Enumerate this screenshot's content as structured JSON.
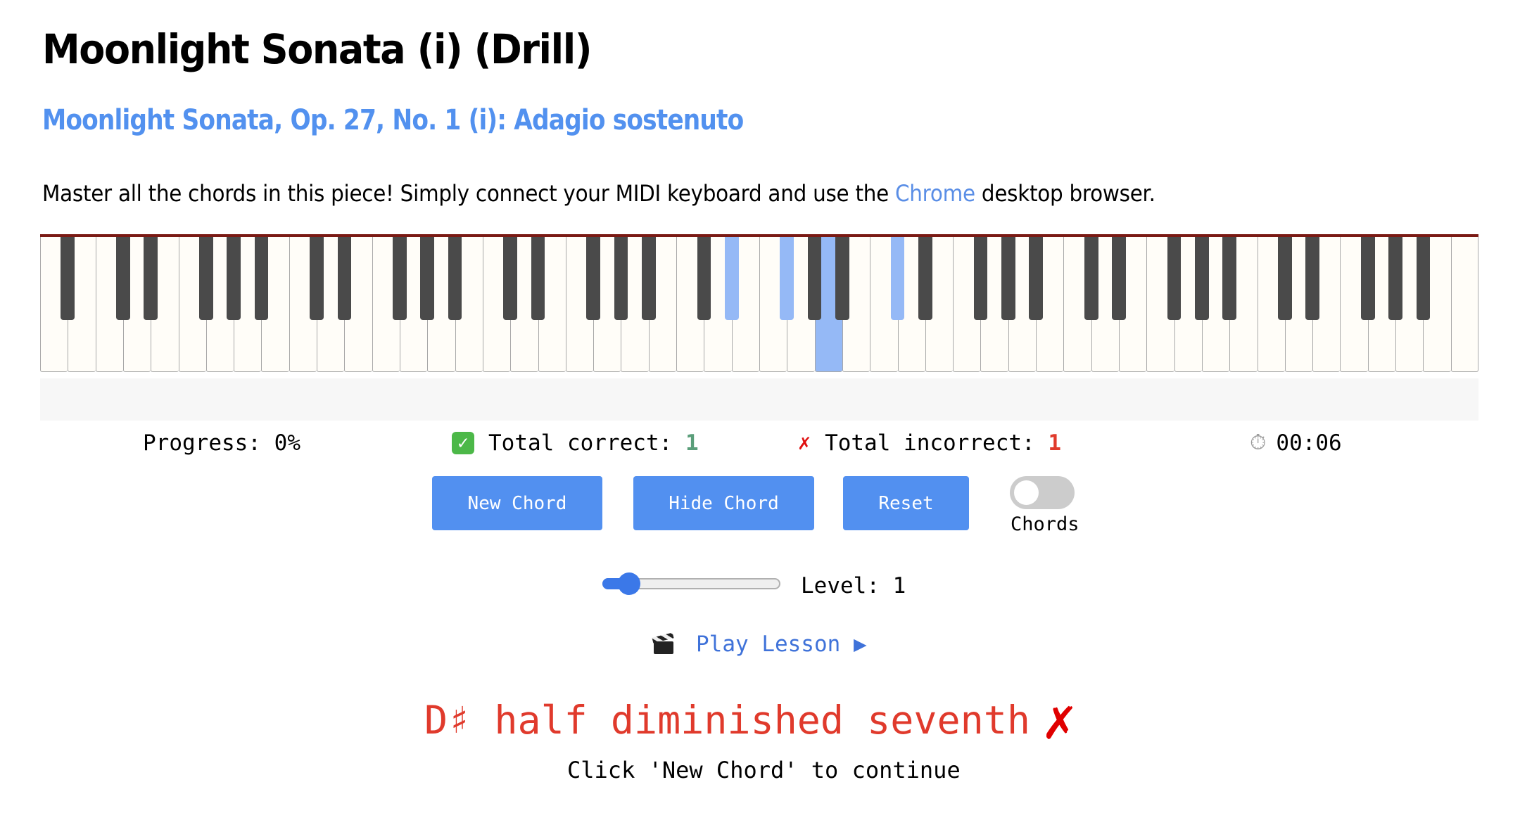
{
  "page": {
    "title": "Moonlight Sonata (i) (Drill)",
    "subtitle": "Moonlight Sonata, Op. 27, No. 1 (i): Adagio sostenuto",
    "intro_before": "Master all the chords in this piece! Simply connect your MIDI keyboard and use the ",
    "intro_link": "Chrome",
    "intro_after": " desktop browser."
  },
  "colors": {
    "accent": "#5290f0",
    "subtitle": "#5291ef",
    "highlight_key": "#95b9f6",
    "keyboard_top_bar": "#7a1a14",
    "correct": "#5a9e7a",
    "incorrect": "#e03b2c"
  },
  "keyboard": {
    "first_note": "A0",
    "last_note": "C8",
    "white_key_count": 52,
    "highlighted_notes": [
      "D#4",
      "F#4",
      "A4",
      "C#5"
    ]
  },
  "stats": {
    "progress_label": "Progress:",
    "progress_value": "0%",
    "correct_icon": "check-mark-button-icon",
    "correct_label": "Total correct:",
    "correct_value": "1",
    "incorrect_icon": "cross-mark-icon",
    "incorrect_label": "Total incorrect:",
    "incorrect_value": "1",
    "timer_icon": "stopwatch-icon",
    "timer_emoji": "⏱",
    "timer_value": "00:06"
  },
  "controls": {
    "new_chord_label": "New Chord",
    "hide_chord_label": "Hide Chord",
    "reset_label": "Reset",
    "toggle_label": "Chords",
    "toggle_on": false
  },
  "level": {
    "label": "Level: 1",
    "value": 1,
    "slider_fraction": 0.15
  },
  "lesson": {
    "icon": "clapper-board-icon",
    "label": "Play Lesson ▶"
  },
  "result": {
    "chord_name": "D♯ half diminished seventh",
    "status_icon": "cross-mark-icon",
    "status_mark": "✗",
    "instruction": "Click 'New Chord' to continue"
  }
}
